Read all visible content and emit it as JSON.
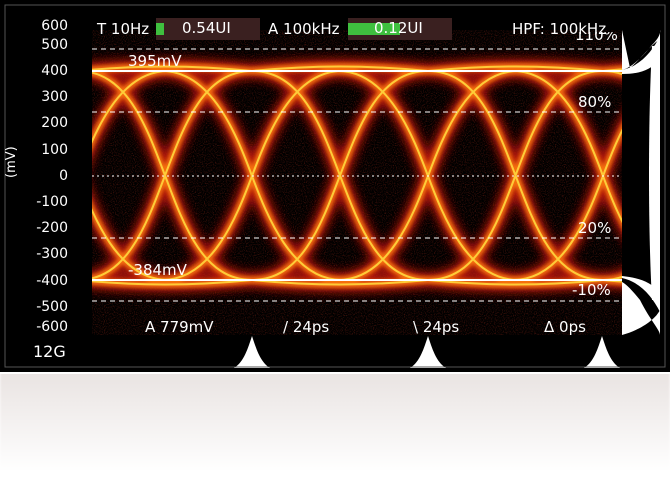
{
  "header": {
    "t_label": "T 10Hz",
    "t_value": "0.54UI",
    "t_level": 0.08,
    "a_label": "A 100kHz",
    "a_value": "0.12UI",
    "a_level": 0.5,
    "hpf_label": "HPF: 100kHz"
  },
  "y_axis": {
    "label": "(mV)",
    "ticks": [
      "600",
      "500",
      "400",
      "300",
      "200",
      "100",
      "0",
      "-100",
      "-200",
      "-300",
      "-400",
      "-500",
      "-600"
    ]
  },
  "levels": {
    "top": "395mV",
    "bottom": "-384mV"
  },
  "percent_labels": {
    "p110": "110%",
    "p80": "80%",
    "p20": "20%",
    "pm10": "-10%"
  },
  "measurements": {
    "amplitude": "A 779mV",
    "rise": "/ 24ps",
    "fall": "\\ 24ps",
    "delta": "Δ 0ps"
  },
  "rate_label": "12G",
  "colors": {
    "trace_core": "#ffd23c",
    "trace_mid": "#ff7a10",
    "trace_edge": "#c8140a",
    "meter": "#3fbf3f",
    "background": "#000000"
  }
}
